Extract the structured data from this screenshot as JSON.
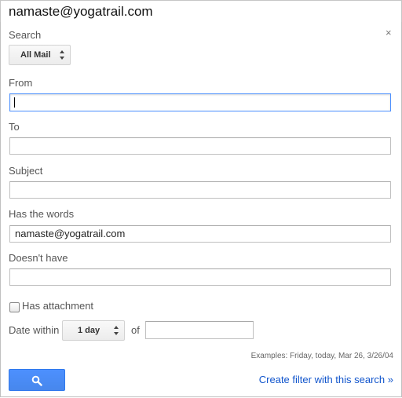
{
  "search_bar": {
    "query": "namaste@yogatrail.com"
  },
  "panel": {
    "search_label": "Search",
    "scope_select": {
      "value": "All Mail"
    },
    "close_glyph": "×",
    "from": {
      "label": "From",
      "value": ""
    },
    "to": {
      "label": "To",
      "value": ""
    },
    "subject": {
      "label": "Subject",
      "value": ""
    },
    "has_words": {
      "label": "Has the words",
      "value": "namaste@yogatrail.com"
    },
    "doesnt_have": {
      "label": "Doesn't have",
      "value": ""
    },
    "attachment": {
      "label": "Has attachment",
      "checked": false
    },
    "date_within": {
      "label": "Date within",
      "value": "1 day",
      "of_label": "of",
      "date_value": ""
    },
    "examples": "Examples: Friday, today, Mar 26, 3/26/04",
    "search_button_icon": "search-icon",
    "create_filter_link": "Create filter with this search »"
  },
  "colors": {
    "accent": "#4d90fe",
    "link": "#1155cc",
    "label": "#555555"
  }
}
